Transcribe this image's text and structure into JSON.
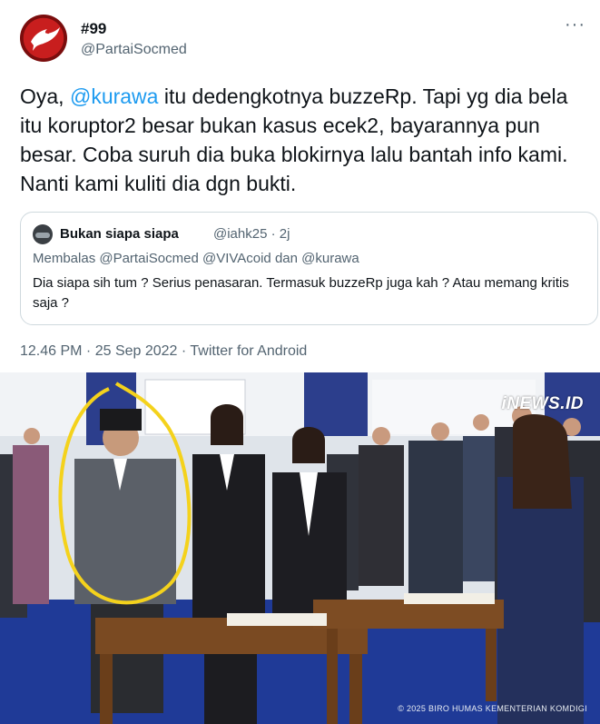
{
  "tweet": {
    "display_name": "#99",
    "handle": "@PartaiSocmed",
    "more_glyph": "···",
    "text_before": "Oya, ",
    "mention": "@kurawa",
    "text_after": " itu dedengkotnya buzzeRp. Tapi yg dia bela itu koruptor2 besar bukan kasus ecek2, bayarannya pun besar. Coba suruh dia buka blokirnya lalu bantah info kami. Nanti kami kuliti dia dgn bukti.",
    "timestamp": "12.46 PM · 25 Sep 2022 · Twitter for Android"
  },
  "quote": {
    "name": "Bukan siapa siapa",
    "meta": "@iahk25 · 2j",
    "reply_line": "Membalas @PartaiSocmed @VIVAcoid dan @kurawa",
    "text": "Dia siapa sih tum ? Serius penasaran. Termasuk buzzeRp juga kah ? Atau memang kritis saja ?"
  },
  "photo": {
    "watermark": "iNEWS.ID",
    "credit": "© 2025 BIRO HUMAS KEMENTERIAN KOMDIGI"
  },
  "colors": {
    "link": "#1d9bf0",
    "secondary_text": "#536471",
    "border": "#cfd9de",
    "highlight_circle": "#f4d21c"
  }
}
